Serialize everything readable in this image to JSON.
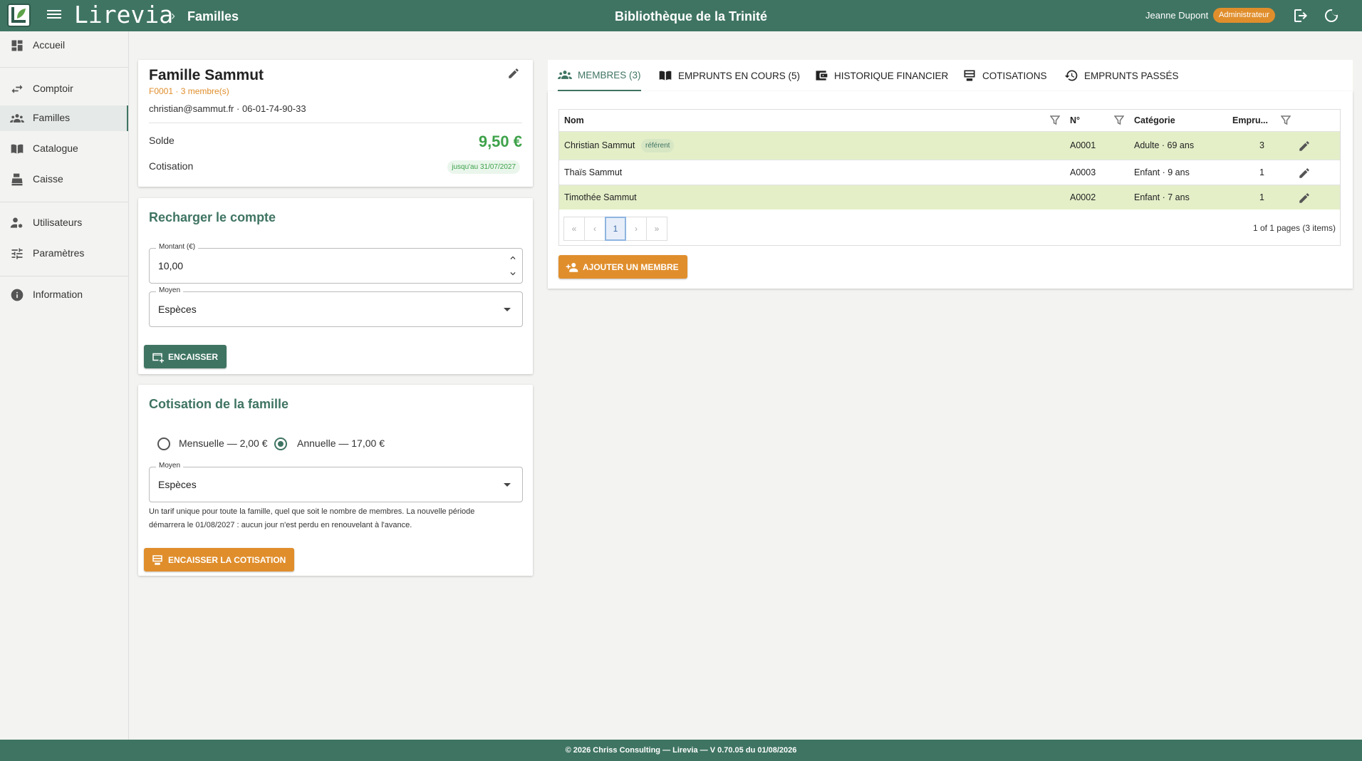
{
  "header": {
    "brand": "Lirevia",
    "breadcrumb_sep": "›",
    "breadcrumb": "Familles",
    "library": "Bibliothèque de la Trinité",
    "user_name": "Jeanne Dupont",
    "user_role": "Administrateur"
  },
  "sidebar": {
    "items": [
      {
        "label": "Accueil",
        "icon": "dashboard-icon"
      },
      {
        "label": "Comptoir",
        "icon": "swap-icon"
      },
      {
        "label": "Familles",
        "icon": "people-icon",
        "active": true
      },
      {
        "label": "Catalogue",
        "icon": "book-icon"
      },
      {
        "label": "Caisse",
        "icon": "cash-register-icon"
      },
      {
        "label": "Utilisateurs",
        "icon": "user-settings-icon"
      },
      {
        "label": "Paramètres",
        "icon": "tune-icon"
      },
      {
        "label": "Information",
        "icon": "info-icon"
      }
    ]
  },
  "family": {
    "name": "Famille Sammut",
    "subtitle": "F0001 · 3 membre(s)",
    "contact": "christian@sammut.fr · 06-01-74-90-33",
    "balance_label": "Solde",
    "balance": "9,50 €",
    "subscription_label": "Cotisation",
    "subscription_until": "jusqu'au 31/07/2027"
  },
  "recharge": {
    "title": "Recharger le compte",
    "amount_label": "Montant (€)",
    "amount_value": "10,00",
    "method_label": "Moyen",
    "method_value": "Espèces",
    "button": "ENCAISSER"
  },
  "cotisation": {
    "title": "Cotisation de la famille",
    "option_monthly": "Mensuelle — 2,00 €",
    "option_yearly": "Annuelle — 17,00 €",
    "selected": "yearly",
    "method_label": "Moyen",
    "method_value": "Espèces",
    "help_line1": "Un tarif unique pour toute la famille, quel que soit le nombre de membres. La nouvelle période",
    "help_line2": "démarrera le 01/08/2027 : aucun jour n'est perdu en renouvelant à l'avance.",
    "button": "ENCAISSER LA COTISATION"
  },
  "tabs": [
    {
      "label": "MEMBRES (3)",
      "icon": "people-icon",
      "active": true
    },
    {
      "label": "EMPRUNTS EN COURS (5)",
      "icon": "book-open-icon"
    },
    {
      "label": "HISTORIQUE FINANCIER",
      "icon": "wallet-icon"
    },
    {
      "label": "COTISATIONS",
      "icon": "card-reader-icon"
    },
    {
      "label": "EMPRUNTS PASSÉS",
      "icon": "history-icon"
    }
  ],
  "members_table": {
    "columns": [
      "Nom",
      "N°",
      "Catégorie",
      "Empru..."
    ],
    "rows": [
      {
        "name": "Christian Sammut",
        "badge": "référent",
        "number": "A0001",
        "category": "Adulte · 69 ans",
        "loans": "3",
        "highlight": true
      },
      {
        "name": "Thaïs Sammut",
        "badge": "",
        "number": "A0003",
        "category": "Enfant · 9 ans",
        "loans": "1",
        "highlight": false
      },
      {
        "name": "Timothée Sammut",
        "badge": "",
        "number": "A0002",
        "category": "Enfant · 7 ans",
        "loans": "1",
        "highlight": true
      }
    ],
    "pager": {
      "first": "«",
      "prev": "‹",
      "current": "1",
      "next": "›",
      "last": "»",
      "info": "1 of 1 pages (3 items)"
    },
    "add_button": "AJOUTER UN MEMBRE"
  },
  "footer": "© 2026 Chriss Consulting — Lirevia — V 0.70.05 du 01/08/2026",
  "colors": {
    "primary": "#3f7463",
    "accent": "#e08e2c",
    "success": "#3ea24a",
    "row_highlight": "#e4efc8"
  }
}
